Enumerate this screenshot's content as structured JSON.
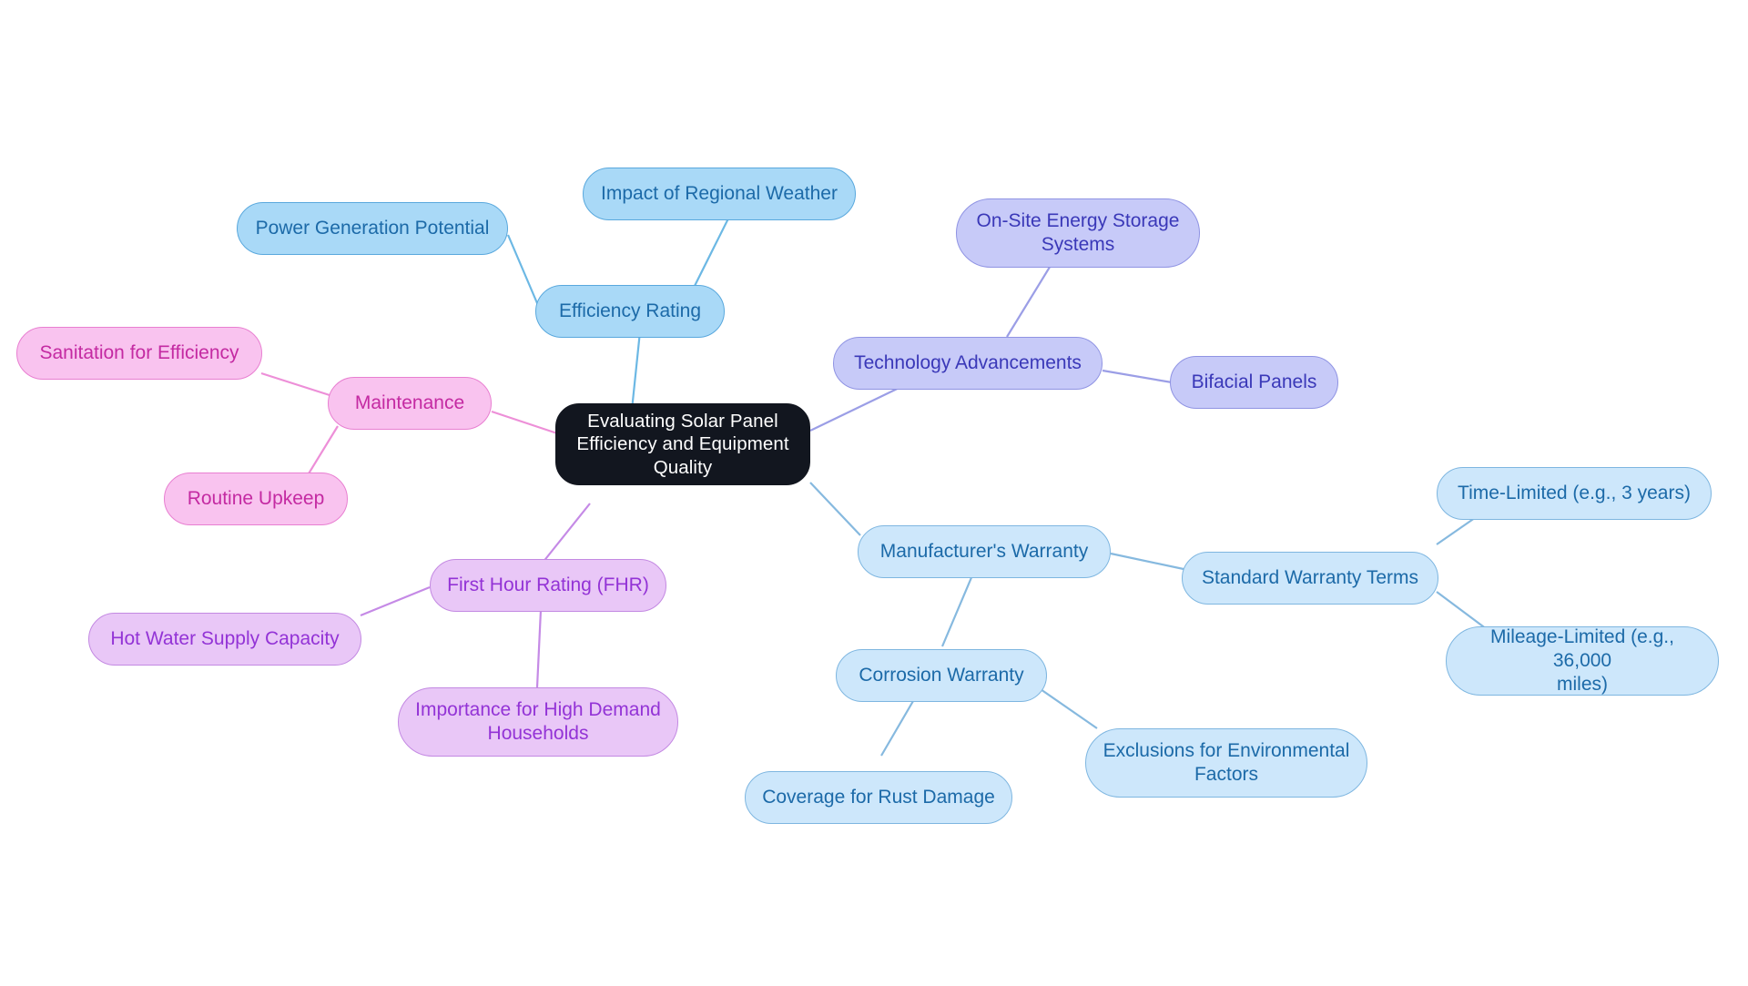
{
  "diagram": {
    "type": "mindmap",
    "title": "Evaluating Solar Panel Efficiency and Equipment Quality",
    "background_color": "#ffffff",
    "palette": {
      "root_fill": "#12161f",
      "root_text": "#ffffff",
      "blue_mid_fill": "#a9d9f7",
      "blue_mid_text": "#1c6aa8",
      "blue_light_fill": "#cde7fb",
      "blue_light_text": "#1c6aa8",
      "pink_fill": "#f9c3ef",
      "pink_text": "#c42aa2",
      "purple_fill": "#e9c7f7",
      "purple_text": "#9333d6",
      "periwinkle_fill": "#c7caf8",
      "periwinkle_text": "#3a38b8"
    }
  },
  "nodes": {
    "root": "Evaluating Solar Panel\nEfficiency and Equipment\nQuality",
    "efficiency_rating": "Efficiency Rating",
    "power_generation_potential": "Power Generation Potential",
    "impact_of_regional_weather": "Impact of Regional Weather",
    "maintenance": "Maintenance",
    "sanitation_for_efficiency": "Sanitation for Efficiency",
    "routine_upkeep": "Routine Upkeep",
    "first_hour_rating": "First Hour Rating (FHR)",
    "hot_water_supply_capacity": "Hot Water Supply Capacity",
    "importance_for_high_demand_households": "Importance for High Demand\nHouseholds",
    "technology_advancements": "Technology Advancements",
    "on_site_energy_storage_systems": "On-Site Energy Storage\nSystems",
    "bifacial_panels": "Bifacial Panels",
    "manufacturers_warranty": "Manufacturer's Warranty",
    "standard_warranty_terms": "Standard Warranty Terms",
    "time_limited": "Time-Limited (e.g., 3 years)",
    "mileage_limited": "Mileage-Limited (e.g., 36,000\nmiles)",
    "corrosion_warranty": "Corrosion Warranty",
    "coverage_for_rust_damage": "Coverage for Rust Damage",
    "exclusions_for_environmental_factors": "Exclusions for Environmental\nFactors"
  },
  "edges": [
    {
      "from": "root",
      "to": "efficiency_rating",
      "color": "#6cb8e4"
    },
    {
      "from": "efficiency_rating",
      "to": "power_generation_potential",
      "color": "#6cb8e4"
    },
    {
      "from": "efficiency_rating",
      "to": "impact_of_regional_weather",
      "color": "#6cb8e4"
    },
    {
      "from": "root",
      "to": "maintenance",
      "color": "#ed8fd8"
    },
    {
      "from": "maintenance",
      "to": "sanitation_for_efficiency",
      "color": "#ed8fd8"
    },
    {
      "from": "maintenance",
      "to": "routine_upkeep",
      "color": "#ed8fd8"
    },
    {
      "from": "root",
      "to": "first_hour_rating",
      "color": "#c58ae6"
    },
    {
      "from": "first_hour_rating",
      "to": "hot_water_supply_capacity",
      "color": "#c58ae6"
    },
    {
      "from": "first_hour_rating",
      "to": "importance_for_high_demand_households",
      "color": "#c58ae6"
    },
    {
      "from": "root",
      "to": "technology_advancements",
      "color": "#9b9ee6"
    },
    {
      "from": "technology_advancements",
      "to": "on_site_energy_storage_systems",
      "color": "#9b9ee6"
    },
    {
      "from": "technology_advancements",
      "to": "bifacial_panels",
      "color": "#9b9ee6"
    },
    {
      "from": "root",
      "to": "manufacturers_warranty",
      "color": "#86b9df"
    },
    {
      "from": "manufacturers_warranty",
      "to": "standard_warranty_terms",
      "color": "#86b9df"
    },
    {
      "from": "standard_warranty_terms",
      "to": "time_limited",
      "color": "#86b9df"
    },
    {
      "from": "standard_warranty_terms",
      "to": "mileage_limited",
      "color": "#86b9df"
    },
    {
      "from": "manufacturers_warranty",
      "to": "corrosion_warranty",
      "color": "#86b9df"
    },
    {
      "from": "corrosion_warranty",
      "to": "coverage_for_rust_damage",
      "color": "#86b9df"
    },
    {
      "from": "corrosion_warranty",
      "to": "exclusions_for_environmental_factors",
      "color": "#86b9df"
    }
  ]
}
